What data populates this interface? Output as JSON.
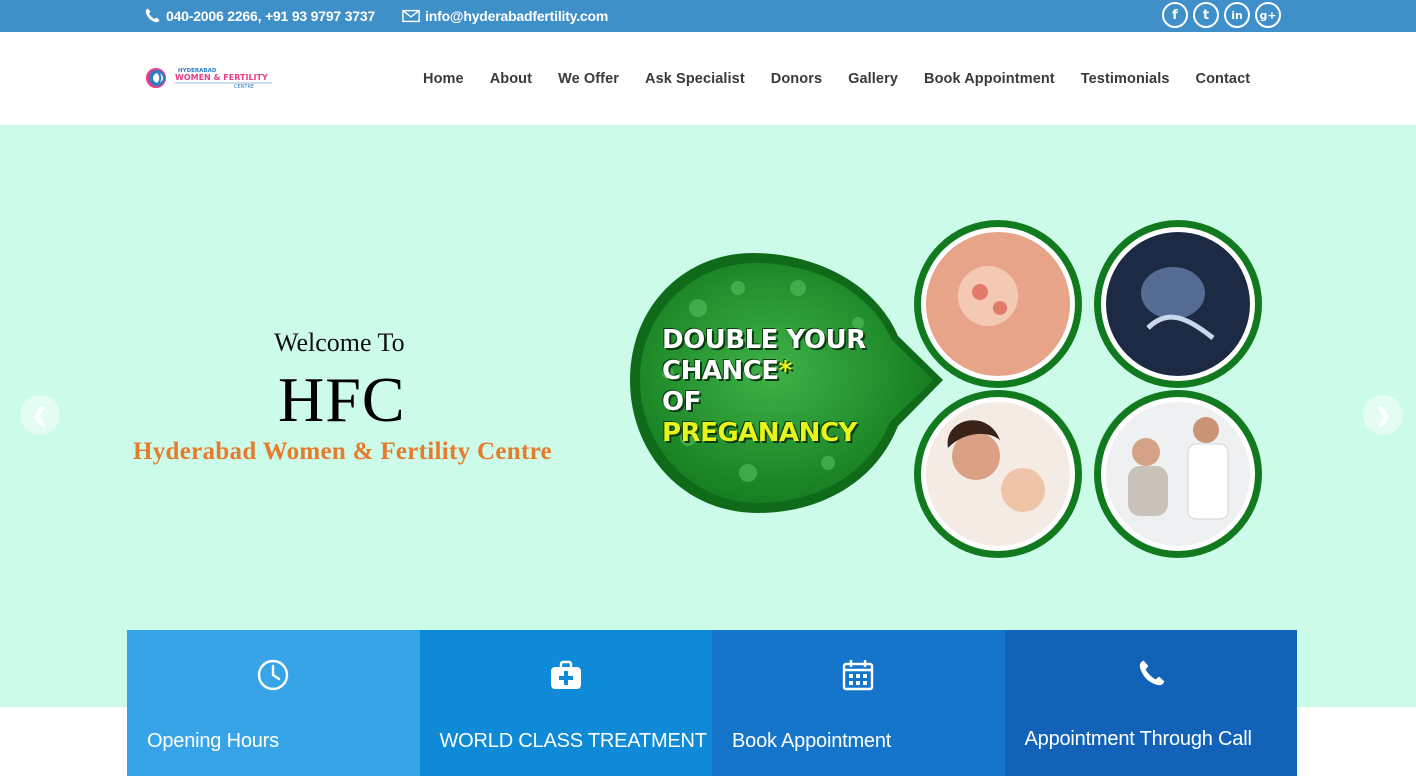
{
  "topbar": {
    "phone": "040-2006 2266,  +91 93 9797 3737",
    "email": "info@hyderabadfertility.com",
    "social": [
      {
        "icon": "facebook-icon",
        "glyph": "f"
      },
      {
        "icon": "twitter-icon",
        "glyph": "t"
      },
      {
        "icon": "linkedin-icon",
        "glyph": "in"
      },
      {
        "icon": "google-plus-icon",
        "glyph": "g+"
      }
    ]
  },
  "header": {
    "logo": {
      "line1": "HYDERABAD",
      "line2": "WOMEN & FERTILITY",
      "line3": "CENTRE"
    },
    "nav": [
      "Home",
      "About",
      "We Offer",
      "Ask Specialist",
      "Donors",
      "Gallery",
      "Book Appointment",
      "Testimonials",
      "Contact"
    ]
  },
  "hero": {
    "welcome": "Welcome To",
    "title": "HFC",
    "subtitle": "Hyderabad Women & Fertility Centre",
    "banner": {
      "line1": "DOUBLE YOUR",
      "line2": "CHANCE",
      "star": "*",
      "line3": "OF",
      "line4": "PREGANANCY"
    }
  },
  "features": [
    {
      "label": "Opening Hours",
      "icon": "clock-icon"
    },
    {
      "label": "WORLD CLASS TREATMENT",
      "icon": "medical-kit-icon"
    },
    {
      "label": "Book Appointment",
      "icon": "calendar-icon"
    },
    {
      "label": "Appointment Through Call",
      "icon": "phone-icon"
    }
  ],
  "colors": {
    "topbar": "#3f8fc9",
    "hero_bg": "#cdfbe9",
    "accent_orange": "#e77b2c",
    "banner_green": "#15801f"
  }
}
